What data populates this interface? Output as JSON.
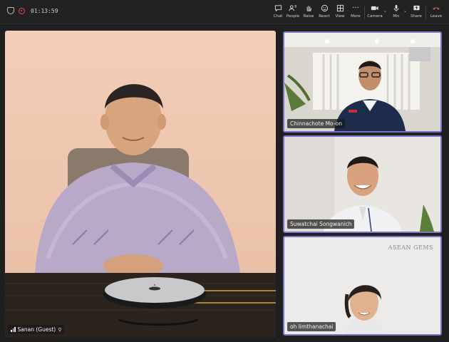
{
  "meeting": {
    "timer": "01:13:59"
  },
  "toolbar": {
    "chat": "Chat",
    "people": "People",
    "people_count": "8",
    "raise": "Raise",
    "react": "React",
    "view": "View",
    "more": "More",
    "camera": "Camera",
    "mic": "Mic",
    "share": "Share",
    "leave": "Leave"
  },
  "participants": {
    "main": "Sanan (Guest)",
    "p1": "Chinnachote Mo-on",
    "p2": "Suwatchai Songwanich",
    "p3": "oh limthanachai"
  },
  "brand_text": "ASEAN GEMS",
  "colors": {
    "speaker_border": "#7b75c9",
    "leave_red": "#e25a5a"
  }
}
